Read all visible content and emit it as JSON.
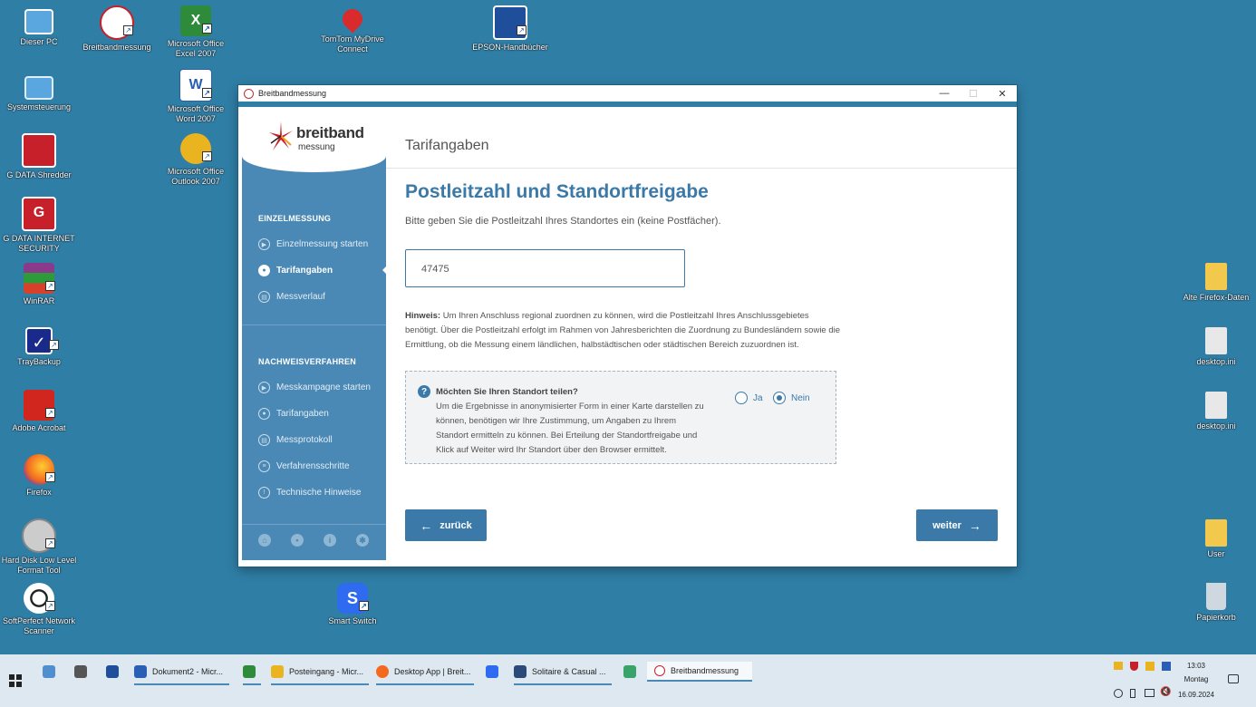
{
  "desktop": {
    "icons": [
      {
        "label": "Dieser PC",
        "icon": "computer-icon",
        "color": "#5aa7e0"
      },
      {
        "label": "Breitbandmessung",
        "icon": "speedometer-icon",
        "color": "#ffffff"
      },
      {
        "label": "Microsoft Office Excel 2007",
        "icon": "excel-icon",
        "color": "#2e8b3a"
      },
      {
        "label": "TomTom MyDrive Connect",
        "icon": "map-pin-icon",
        "color": "#d92b2b"
      },
      {
        "label": "EPSON-Handbücher",
        "icon": "monitor-icon",
        "color": "#1f4f9a"
      },
      {
        "label": "Systemsteuerung",
        "icon": "control-panel-icon",
        "color": "#5aa7e0"
      },
      {
        "label": "Microsoft Office Word 2007",
        "icon": "word-icon",
        "color": "#2b5fb5"
      },
      {
        "label": "G DATA Shredder",
        "icon": "shredder-icon",
        "color": "#c8202a"
      },
      {
        "label": "Microsoft Office Outlook 2007",
        "icon": "outlook-icon",
        "color": "#e9b420"
      },
      {
        "label": "G DATA INTERNET SECURITY",
        "icon": "shield-icon",
        "color": "#c8202a"
      },
      {
        "label": "WinRAR",
        "icon": "archive-icon",
        "color": "#8b3a8b"
      },
      {
        "label": "TrayBackup",
        "icon": "checkmark-icon",
        "color": "#1a2a8a"
      },
      {
        "label": "Adobe Acrobat",
        "icon": "pdf-icon",
        "color": "#d0261e"
      },
      {
        "label": "Firefox",
        "icon": "firefox-icon",
        "color": "#f36a1f"
      },
      {
        "label": "Hard Disk Low Level Format Tool",
        "icon": "disk-icon",
        "color": "#cccccc"
      },
      {
        "label": "SoftPerfect Network Scanner",
        "icon": "soccer-ball-icon",
        "color": "#ffffff"
      },
      {
        "label": "Smart Switch",
        "icon": "smart-switch-icon",
        "color": "#2f6bf0"
      },
      {
        "label": "Alte Firefox-Daten",
        "icon": "folder-icon",
        "color": "#f2c94c"
      },
      {
        "label": "desktop.ini",
        "icon": "settings-file-icon",
        "color": "#e8e8e8"
      },
      {
        "label": "desktop.ini",
        "icon": "settings-file-icon",
        "color": "#e8e8e8"
      },
      {
        "label": "User",
        "icon": "user-folder-icon",
        "color": "#f2c94c"
      },
      {
        "label": "Papierkorb",
        "icon": "recycle-bin-icon",
        "color": "#cfd8df"
      }
    ]
  },
  "window": {
    "title": "Breitbandmessung",
    "controls": {
      "minimize": "—",
      "maximize": "☐",
      "close": "✕"
    }
  },
  "logo": {
    "word1": "breitband",
    "word2": "messung"
  },
  "sidebar": {
    "section1": "EINZELMESSUNG",
    "items1": [
      {
        "label": "Einzelmessung starten",
        "icon": "play-icon"
      },
      {
        "label": "Tarifangaben",
        "icon": "user-icon",
        "active": true
      },
      {
        "label": "Messverlauf",
        "icon": "history-icon"
      }
    ],
    "section2": "NACHWEISVERFAHREN",
    "items2": [
      {
        "label": "Messkampagne starten",
        "icon": "play-icon"
      },
      {
        "label": "Tarifangaben",
        "icon": "user-icon"
      },
      {
        "label": "Messprotokoll",
        "icon": "document-icon"
      },
      {
        "label": "Verfahrensschritte",
        "icon": "list-icon"
      },
      {
        "label": "Technische Hinweise",
        "icon": "warning-icon"
      }
    ],
    "bottom_icons": [
      "home-icon",
      "chat-icon",
      "info-icon",
      "gear-icon"
    ]
  },
  "main": {
    "page_header": "Tarifangaben",
    "heading": "Postleitzahl und Standortfreigabe",
    "subtitle": "Bitte geben Sie die Postleitzahl Ihres Standortes ein (keine Postfächer).",
    "plz_value": "47475",
    "hint_label": "Hinweis:",
    "hint_text": " Um Ihren Anschluss regional zuordnen zu können, wird die Postleitzahl Ihres Anschlussgebietes benötigt. Über die Postleitzahl erfolgt im Rahmen von Jahresberichten die Zuordnung zu Bundesländern sowie die Ermittlung, ob die Messung einem ländlichen, halbstädtischen oder städtischen Bereich zuzuordnen ist.",
    "share": {
      "question": "Möchten Sie Ihren Standort teilen?",
      "text": "Um die Ergebnisse in anonymisierter Form in einer Karte darstellen zu können, benötigen wir Ihre Zustimmung, um Angaben zu Ihrem Standort ermitteln zu können. Bei Erteilung der Standortfreigabe und Klick auf Weiter wird Ihr Standort über den Browser ermittelt.",
      "option_yes": "Ja",
      "option_no": "Nein",
      "selected": "Nein"
    },
    "back_button": "zurück",
    "next_button": "weiter"
  },
  "taskbar": {
    "items": [
      {
        "label": "",
        "icon": "explorer-icon",
        "color": "#4f8fd0"
      },
      {
        "label": "",
        "icon": "calculator-icon",
        "color": "#555555"
      },
      {
        "label": "",
        "icon": "scanner-icon",
        "color": "#1f4f9a"
      },
      {
        "label": "Dokument2 - Micr...",
        "icon": "word-icon",
        "color": "#2b5fb5"
      },
      {
        "label": "",
        "icon": "excel-icon",
        "color": "#2e8b3a"
      },
      {
        "label": "Posteingang - Micr...",
        "icon": "outlook-icon",
        "color": "#e9b420"
      },
      {
        "label": "Desktop App | Breit...",
        "icon": "firefox-icon",
        "color": "#f36a1f"
      },
      {
        "label": "",
        "icon": "smart-switch-icon",
        "color": "#2f6bf0"
      },
      {
        "label": "Solitaire & Casual ...",
        "icon": "cards-icon",
        "color": "#2a4a7a"
      },
      {
        "label": "",
        "icon": "app-icon",
        "color": "#3aa36a"
      },
      {
        "label": "Breitbandmessung",
        "icon": "speedometer-icon",
        "color": "#c8202a"
      }
    ],
    "time": "13:03",
    "day": "Montag",
    "date": "16.09.2024"
  }
}
